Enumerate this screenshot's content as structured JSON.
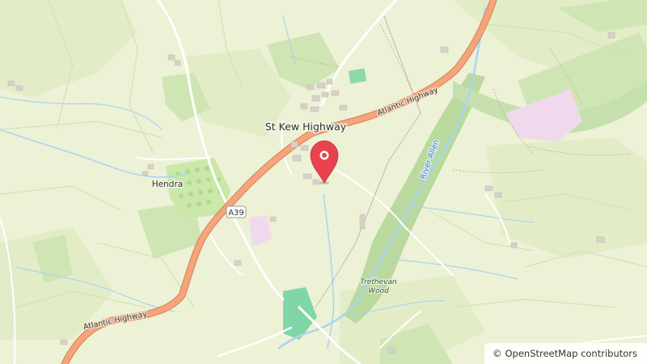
{
  "map": {
    "places": {
      "st_kew_highway": "St Kew Highway",
      "hendra": "Hendra"
    },
    "roads": {
      "atlantic_highway_ne": "Atlantic Highway",
      "atlantic_highway_sw": "Atlantic Highway",
      "a39_shield": "A39"
    },
    "water": {
      "river_allen": "River Allen"
    },
    "woods": {
      "trethevan_line1": "Trethevan",
      "trethevan_line2": "Wood"
    },
    "marker": {
      "icon": "map-pin-icon",
      "color": "#e8424f"
    },
    "colors": {
      "land": "#edf1d6",
      "meadow": "#dbebc0",
      "woodland": "#bfdca6",
      "road_main": "#f6a47c",
      "water": "#aad4f0",
      "orchard": "#c9e8a9",
      "amenity": "#f3dcef"
    }
  },
  "attribution": {
    "symbol": "©",
    "text": "OpenStreetMap contributors"
  }
}
